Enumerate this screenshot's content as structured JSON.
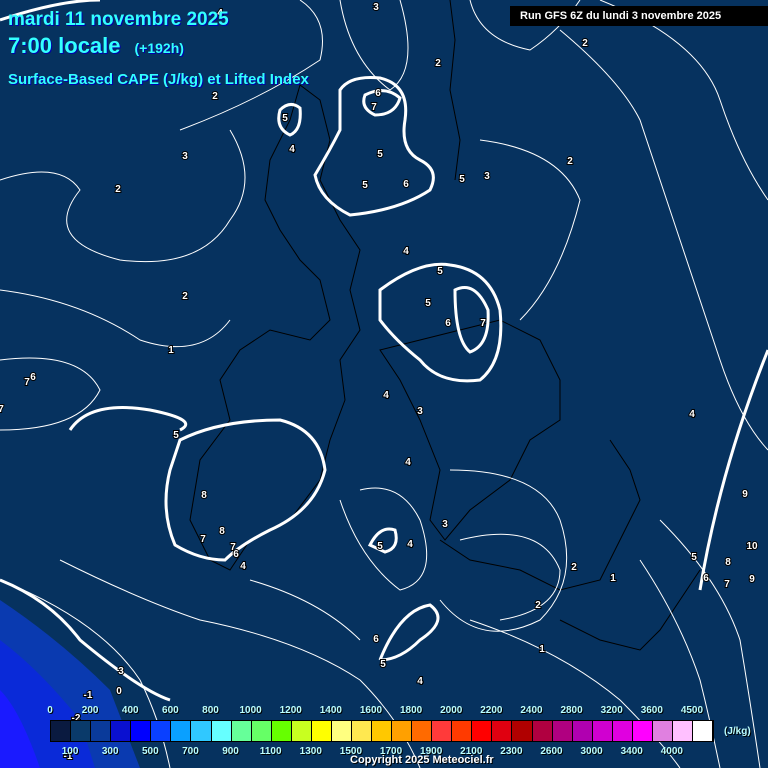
{
  "header": {
    "date": "mardi 11 novembre 2025",
    "time": "7:00 locale",
    "offset": "(+192h)",
    "product": "Surface-Based CAPE (J/kg) et Lifted Index",
    "run": "Run GFS 6Z du lundi 3 novembre 2025"
  },
  "legend": {
    "unit": "(J/kg)",
    "top_labels": [
      "0",
      "200",
      "400",
      "600",
      "800",
      "1000",
      "1200",
      "1400",
      "1600",
      "1800",
      "2000",
      "2200",
      "2400",
      "2800",
      "3200",
      "3600",
      "4500"
    ],
    "bottom_labels": [
      "100",
      "300",
      "500",
      "700",
      "900",
      "1100",
      "1300",
      "1500",
      "1700",
      "1900",
      "2100",
      "2300",
      "2600",
      "3000",
      "3400",
      "4000"
    ],
    "colors": [
      "#0a1a40",
      "#0a3a6a",
      "#0a3a9a",
      "#0a10d0",
      "#0000ff",
      "#0a40ff",
      "#0aa0ff",
      "#30c8ff",
      "#66ffff",
      "#66ff99",
      "#66ff66",
      "#66ff00",
      "#c8ff20",
      "#ffff00",
      "#ffff80",
      "#ffe850",
      "#ffc800",
      "#ffa000",
      "#ff6a00",
      "#ff3a3a",
      "#ff3a00",
      "#ff0000",
      "#e00010",
      "#b00000",
      "#b00040",
      "#b00080",
      "#b000b0",
      "#d000d0",
      "#e000e0",
      "#ff00ff",
      "#e080e0",
      "#ffc0ff",
      "#ffffff"
    ]
  },
  "contour_labels": [
    "4",
    "3",
    "2",
    "2",
    "4",
    "2",
    "3",
    "2",
    "5",
    "4",
    "6",
    "7",
    "5",
    "5",
    "6",
    "5",
    "3",
    "2",
    "4",
    "5",
    "5",
    "6",
    "7",
    "2",
    "1",
    "7",
    "6",
    "5",
    "4",
    "3",
    "4",
    "8",
    "7",
    "8",
    "6",
    "7",
    "4",
    "5",
    "4",
    "3",
    "2",
    "1",
    "2",
    "4",
    "9",
    "10",
    "5",
    "6",
    "7",
    "8",
    "9",
    "6",
    "5",
    "4",
    "1",
    "3",
    "0",
    "-1",
    "-2",
    "-1",
    "7"
  ],
  "copyright": "Copyright 2025 Meteociel.fr",
  "colors": {
    "ocean": "#06325f",
    "title": "#33ffff",
    "negative_li": "#0a2ad8"
  }
}
